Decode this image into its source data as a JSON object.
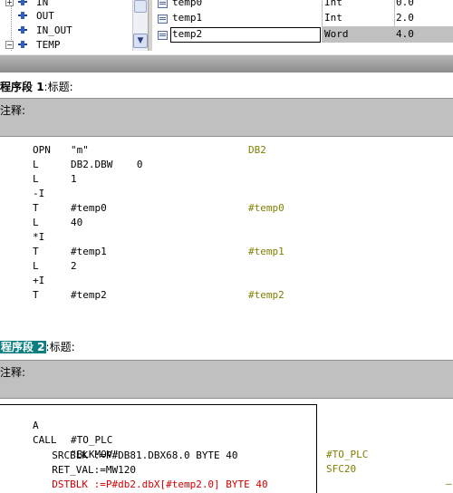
{
  "tree": {
    "items": [
      {
        "label": "IN"
      },
      {
        "label": "OUT"
      },
      {
        "label": "IN_OUT"
      },
      {
        "label": "TEMP"
      }
    ]
  },
  "variables": {
    "rows": [
      {
        "name": "temp0",
        "type": "Int",
        "initial": "0.0"
      },
      {
        "name": "temp1",
        "type": "Int",
        "initial": "2.0"
      },
      {
        "name": "temp2",
        "type": "Word",
        "initial": "4.0"
      }
    ]
  },
  "network1": {
    "title_prefix": "程序段",
    "number": " 1",
    "title_suffix": ":标题:",
    "comment_label": "注释:",
    "lines": [
      {
        "op": "OPN",
        "arg": "\"m\"",
        "comment": "DB2"
      },
      {
        "op": "L",
        "arg": "DB2.DBW    0",
        "comment": ""
      },
      {
        "op": "L",
        "arg": "1",
        "comment": ""
      },
      {
        "op": "-I",
        "arg": "",
        "comment": ""
      },
      {
        "op": "T",
        "arg": "#temp0",
        "comment": "#temp0"
      },
      {
        "op": "L",
        "arg": "40",
        "comment": ""
      },
      {
        "op": "*I",
        "arg": "",
        "comment": ""
      },
      {
        "op": "T",
        "arg": "#temp1",
        "comment": "#temp1"
      },
      {
        "op": "L",
        "arg": "2",
        "comment": ""
      },
      {
        "op": "+I",
        "arg": "",
        "comment": ""
      },
      {
        "op": "T",
        "arg": "#temp2",
        "comment": "#temp2"
      }
    ]
  },
  "network2": {
    "title_highlight": "程序段 2",
    "title_suffix": ":标题:",
    "comment_label": "注释:",
    "line1_op": "A",
    "line1_arg": "#TO_PLC",
    "line1_comment": "#TO_PLC",
    "line2_op": "CALL",
    "line2_arg": "\"BLKMOV\"",
    "line2_comment": "SFC20",
    "line2_dash": "—",
    "param1": "SRCBLK :=P#DB81.DBX68.0 BYTE 40",
    "param2": "RET_VAL:=MW120",
    "param3": "DSTBLK :=P#db2.dbX[#temp2.0] BYTE 40"
  }
}
